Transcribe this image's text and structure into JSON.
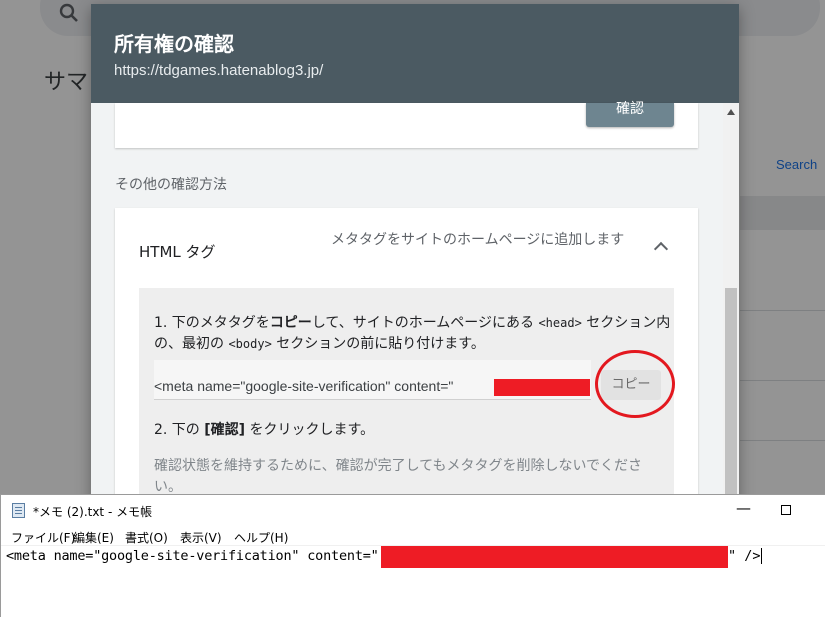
{
  "background": {
    "page_title": "サマ",
    "link_text": "Search"
  },
  "dialog": {
    "title": "所有権の確認",
    "url": "https://tdgames.hatenablog3.jp/",
    "confirm_button": "確認",
    "other_methods_heading": "その他の確認方法",
    "html_tag": {
      "label": "HTML タグ",
      "description": "メタタグをサイトのホームページに追加します",
      "step1_parts": [
        "1. 下のメタタグを",
        "コピー",
        "して、サイトのホームページにある ",
        "<head>",
        " セクション内の、最初の ",
        "<body>",
        " セクションの前に貼り付けます。"
      ],
      "meta_snippet": "<meta name=\"google-site-verification\" content=\"",
      "copy_button": "コピー",
      "step2_prefix": "2. 下の ",
      "step2_bold": "[確認]",
      "step2_suffix": " をクリックします。",
      "note": "確認状態を維持するために、確認が完了してもメタタグを削除しないでください。"
    }
  },
  "notepad": {
    "title": "*メモ (2).txt - メモ帳",
    "menu": [
      "ファイル(F)",
      "編集(E)",
      "書式(O)",
      "表示(V)",
      "ヘルプ(H)"
    ],
    "text_start": "<meta name=\"google-site-verification\" content=\"",
    "text_end": "\" />",
    "min_symbol": "—"
  },
  "colors": {
    "header": "#4b5a62",
    "redaction": "#ee1c25",
    "annotation": "#e3181f",
    "link": "#1a73e8"
  }
}
